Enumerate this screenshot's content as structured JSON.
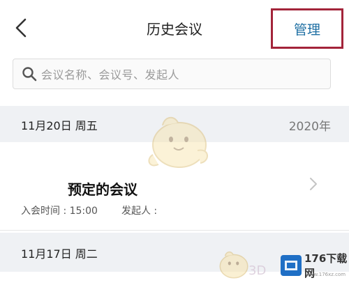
{
  "header": {
    "title": "历史会议",
    "manage_label": "管理",
    "back_icon": "chevron-left-icon",
    "accent_color": "#1e6fa3",
    "highlight_color": "#a3243a"
  },
  "search": {
    "placeholder": "会议名称、会议号、发起人",
    "icon": "search-icon"
  },
  "groups": [
    {
      "date": "11月20日 周五",
      "year": "2020年",
      "meetings": [
        {
          "title": "预定的会议",
          "join_time_label": "入会时间 : 15:00",
          "organizer_label": "发起人 :"
        }
      ]
    },
    {
      "date": "11月17日 周二"
    }
  ],
  "watermark": {
    "brand": "176下载网",
    "url": "www.176xz.com",
    "overlay_text": "3D"
  }
}
